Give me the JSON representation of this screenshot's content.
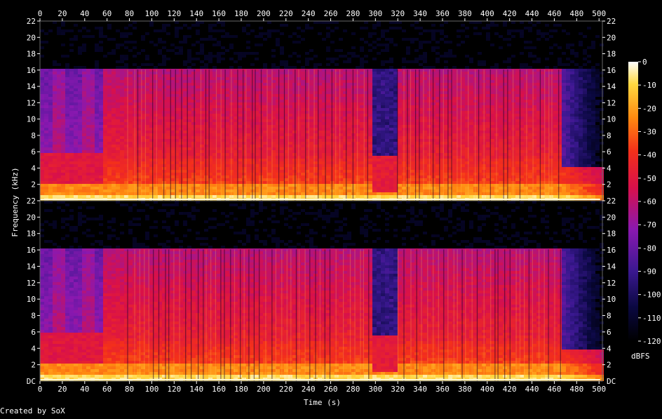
{
  "chart_data": {
    "type": "heatmap",
    "title": "",
    "xlabel": "Time (s)",
    "ylabel": "Frequency (kHz)",
    "xlim": [
      0,
      503
    ],
    "x_ticks": [
      "0",
      "20",
      "40",
      "60",
      "80",
      "100",
      "120",
      "140",
      "160",
      "180",
      "200",
      "220",
      "240",
      "260",
      "280",
      "300",
      "320",
      "340",
      "360",
      "380",
      "400",
      "420",
      "440",
      "460",
      "480",
      "500"
    ],
    "channels": [
      {
        "name": "",
        "ylim": [
          0,
          22
        ],
        "y_ticks": [
          "22",
          "20",
          "18",
          "16",
          "14",
          "12",
          "10",
          "8",
          "6",
          "4",
          "2"
        ],
        "bottom_label": ""
      },
      {
        "name": "",
        "ylim": [
          0,
          22
        ],
        "y_ticks": [
          "22",
          "20",
          "18",
          "16",
          "14",
          "12",
          "10",
          "8",
          "6",
          "4",
          "2"
        ],
        "bottom_label": "DC"
      }
    ],
    "colorbar": {
      "label": "dBFS",
      "range": [
        -120,
        0
      ],
      "ticks": [
        "0",
        "-10",
        "-20",
        "-30",
        "-40",
        "-50",
        "-60",
        "-70",
        "-80",
        "-90",
        "-100",
        "-110",
        "-120"
      ]
    },
    "features": {
      "lowpass_cutoff_khz": 16,
      "low_band_change_time_s": 58,
      "gap_start_s": 297,
      "gap_end_s": 318,
      "fade_start_s": 467,
      "end_s": 503
    }
  },
  "footer": {
    "credit": "Created by SoX"
  }
}
